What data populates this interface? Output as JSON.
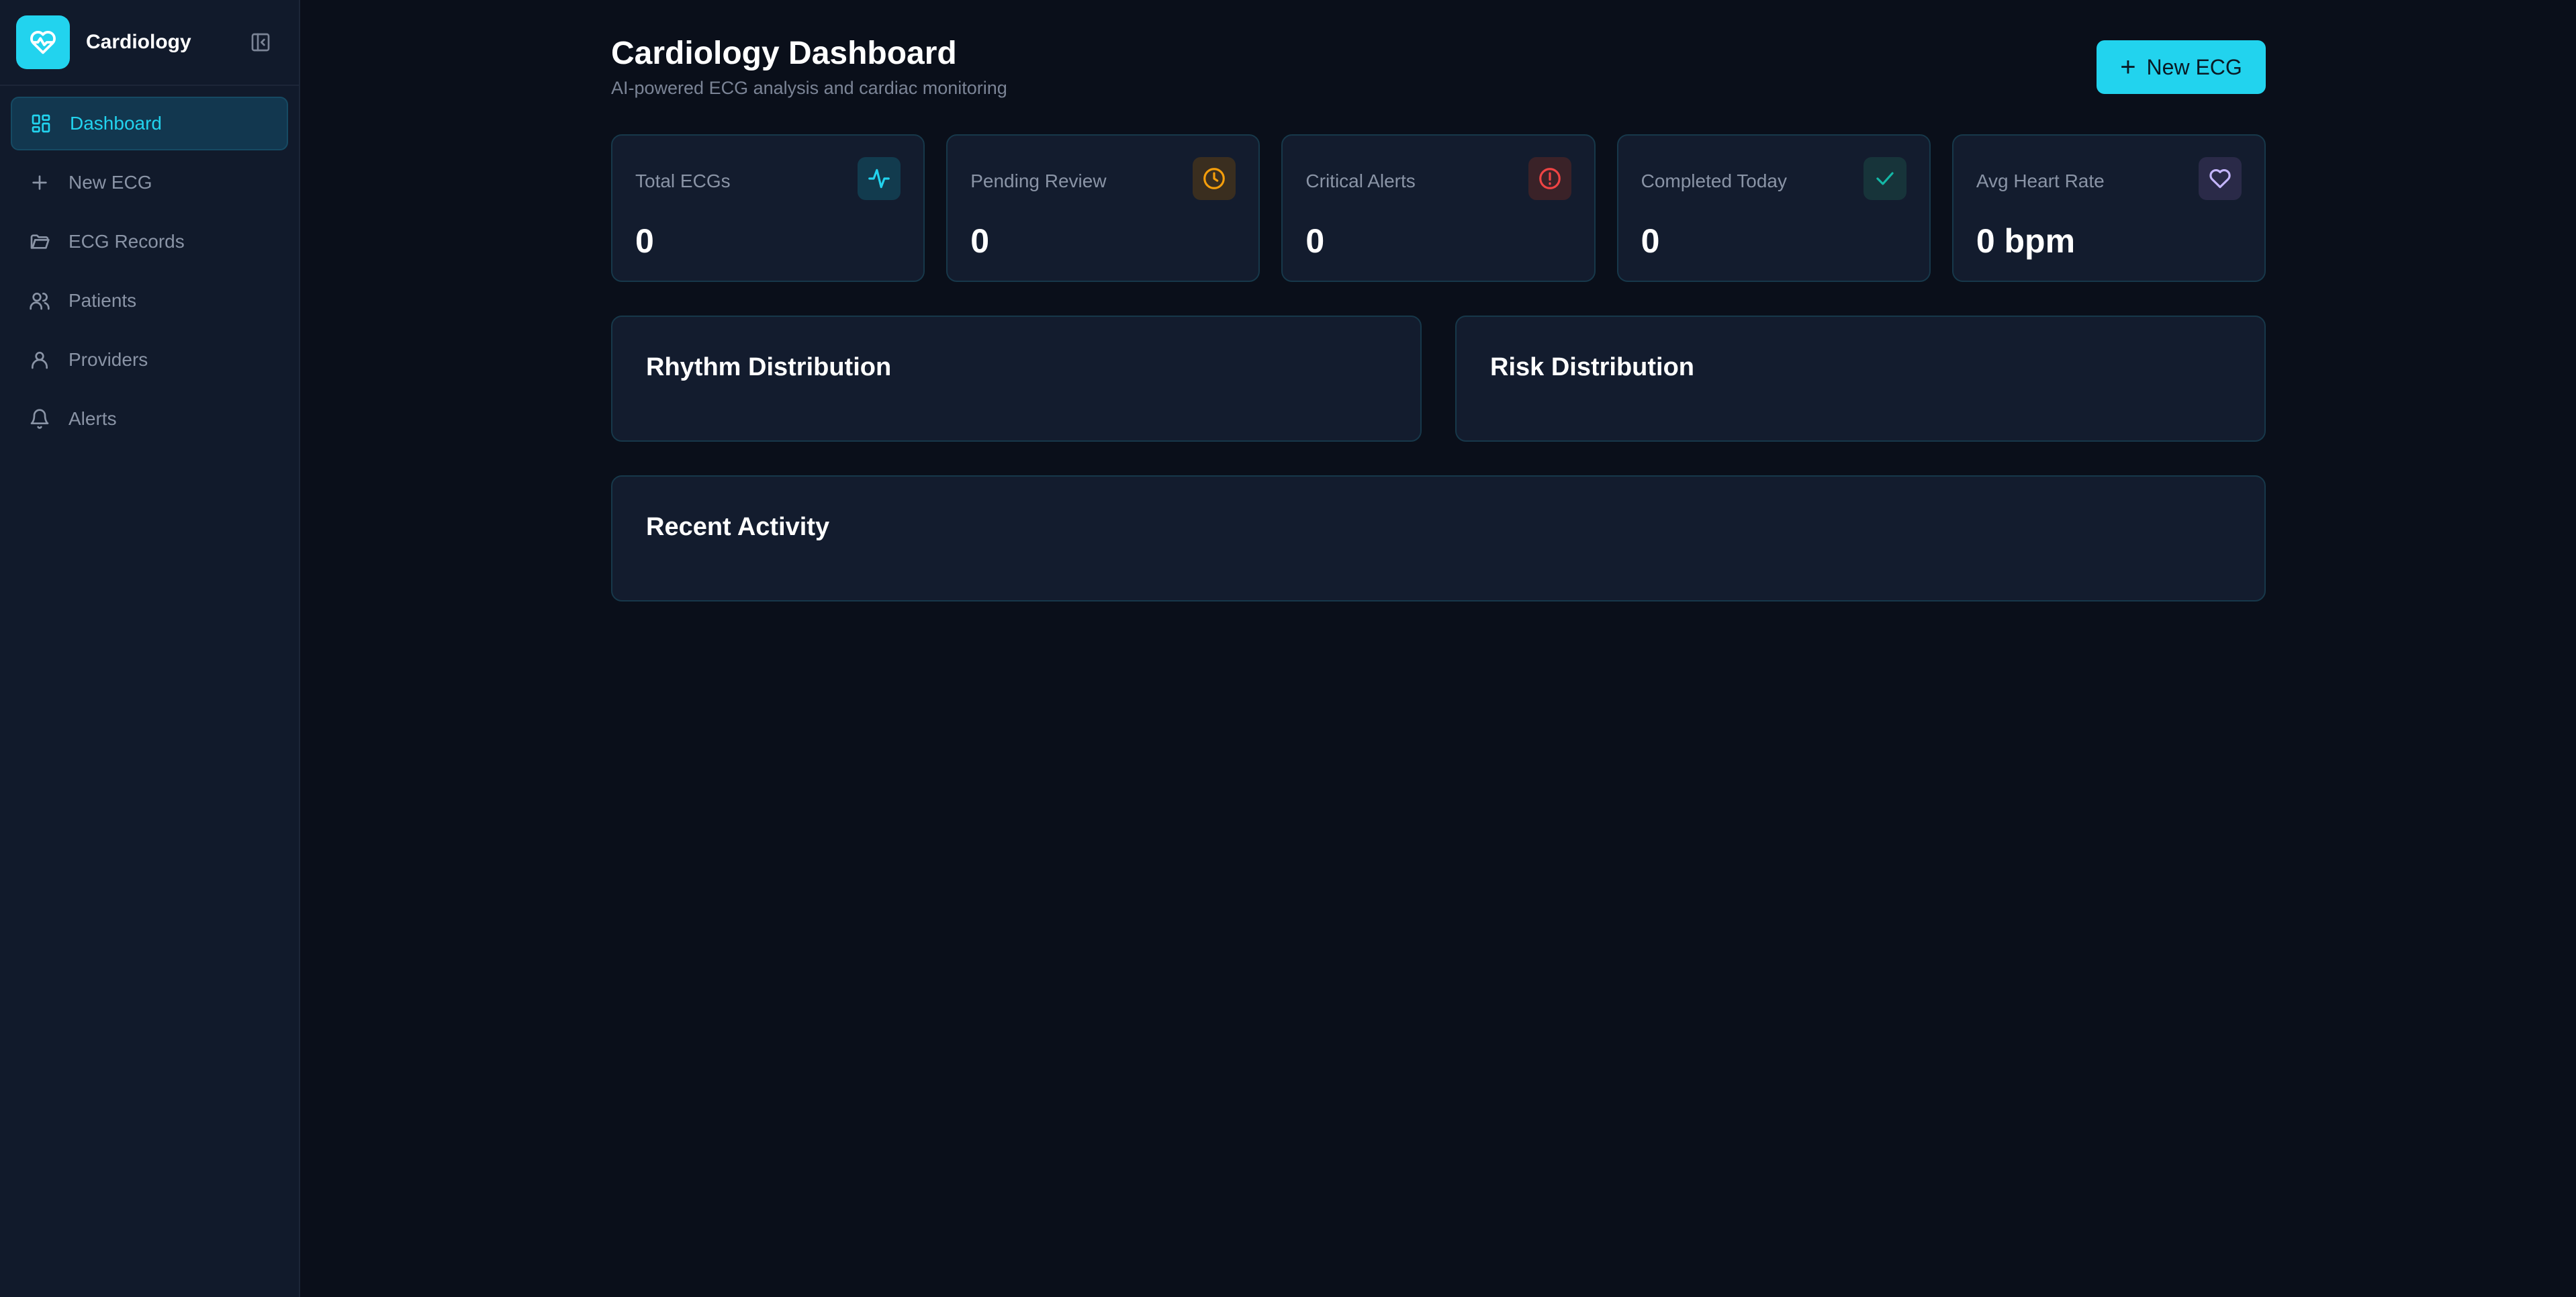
{
  "sidebar": {
    "brand": "Cardiology",
    "items": [
      {
        "label": "Dashboard",
        "icon": "dashboard-icon",
        "active": true
      },
      {
        "label": "New ECG",
        "icon": "plus-icon"
      },
      {
        "label": "ECG Records",
        "icon": "folder-icon"
      },
      {
        "label": "Patients",
        "icon": "users-icon"
      },
      {
        "label": "Providers",
        "icon": "user-icon"
      },
      {
        "label": "Alerts",
        "icon": "bell-icon"
      }
    ]
  },
  "header": {
    "title": "Cardiology Dashboard",
    "subtitle": "AI-powered ECG analysis and cardiac monitoring",
    "new_ecg_label": "New ECG"
  },
  "stats": [
    {
      "label": "Total ECGs",
      "value": "0",
      "icon": "activity-icon",
      "color": "#22d3ee"
    },
    {
      "label": "Pending Review",
      "value": "0",
      "icon": "clock-icon",
      "color": "#f59e0b"
    },
    {
      "label": "Critical Alerts",
      "value": "0",
      "icon": "alert-circle-icon",
      "color": "#ef4444"
    },
    {
      "label": "Completed Today",
      "value": "0",
      "icon": "check-icon",
      "color": "#14b8a6"
    },
    {
      "label": "Avg Heart Rate",
      "value": "0 bpm",
      "icon": "heart-icon",
      "color": "#a78bfa"
    }
  ],
  "panels": {
    "rhythm": "Rhythm Distribution",
    "risk": "Risk Distribution",
    "activity": "Recent Activity"
  },
  "colors": {
    "accent": "#22d3ee",
    "background": "#0a0f1a",
    "sidebar": "#111a2b",
    "card": "#131c2e"
  }
}
